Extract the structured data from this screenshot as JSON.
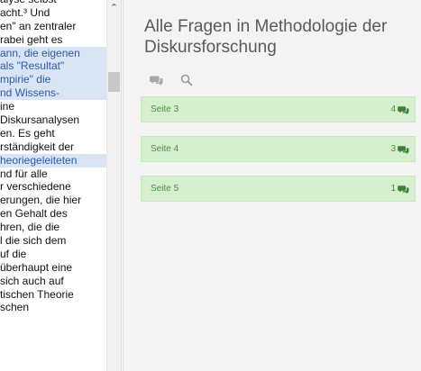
{
  "document": {
    "lines": [
      {
        "text": "alyse selbst",
        "hl": false
      },
      {
        "text": "acht.³ Und",
        "hl": false
      },
      {
        "text": "en\" an zentraler",
        "hl": false
      },
      {
        "text": "rabei geht es",
        "hl": false
      },
      {
        "text": "ann, die eigenen",
        "hl": true
      },
      {
        "text": "als \"Resultat\"",
        "hl": true
      },
      {
        "text": "mpirie\" die",
        "hl": true
      },
      {
        "text": "nd Wissens-",
        "hl": true
      },
      {
        "text": "ine",
        "hl": false
      },
      {
        "text": "Diskursanalysen",
        "hl": false
      },
      {
        "text": "en. Es geht",
        "hl": false
      },
      {
        "text": "rständigkeit der",
        "hl": false
      },
      {
        "text": "heoriegeleiteten",
        "hl": true
      },
      {
        "text": "nd für alle",
        "hl": false
      },
      {
        "text": "r verschiedene",
        "hl": false
      },
      {
        "text": "erungen, die hier",
        "hl": false
      },
      {
        "text": "en Gehalt des",
        "hl": false
      },
      {
        "text": "hren, die die",
        "hl": false
      },
      {
        "text": "l die sich dem",
        "hl": false
      },
      {
        "text": "uf die",
        "hl": false
      },
      {
        "text": "überhaupt eine",
        "hl": false
      },
      {
        "text": "sich auch auf",
        "hl": false
      },
      {
        "text": "tischen Theorie",
        "hl": false
      },
      {
        "text": "schen",
        "hl": false
      }
    ]
  },
  "forum": {
    "title": "Alle Fragen in Methodologie der Diskursforschung",
    "toolbar": {
      "icons": [
        "comments-icon",
        "search-icon"
      ]
    },
    "pages": [
      {
        "label": "Seite 3",
        "count": "4"
      },
      {
        "label": "Seite 4",
        "count": "3"
      },
      {
        "label": "Seite 5",
        "count": "1"
      }
    ]
  },
  "colors": {
    "row_bg": "#d6f0cf",
    "row_text": "#4f8b46",
    "highlight_text": "#2d5aa8",
    "highlight_bg": "#d9e4f5"
  }
}
